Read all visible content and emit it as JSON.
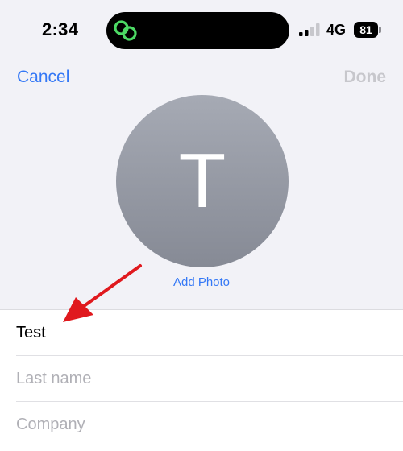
{
  "status_bar": {
    "time": "2:34",
    "network": "4G",
    "battery_level": "81",
    "island_icon": "link-rings-icon",
    "signal_bars_active": 2,
    "signal_bars_total": 4
  },
  "nav": {
    "cancel_label": "Cancel",
    "done_label": "Done"
  },
  "avatar": {
    "initial": "T",
    "add_photo_label": "Add Photo"
  },
  "form": {
    "first_name_value": "Test",
    "last_name_placeholder": "Last name",
    "company_placeholder": "Company"
  },
  "colors": {
    "accent": "#3478f6",
    "disabled": "#c7c7cc",
    "annotation_arrow": "#e0191e",
    "island_icon": "#4cd964"
  }
}
